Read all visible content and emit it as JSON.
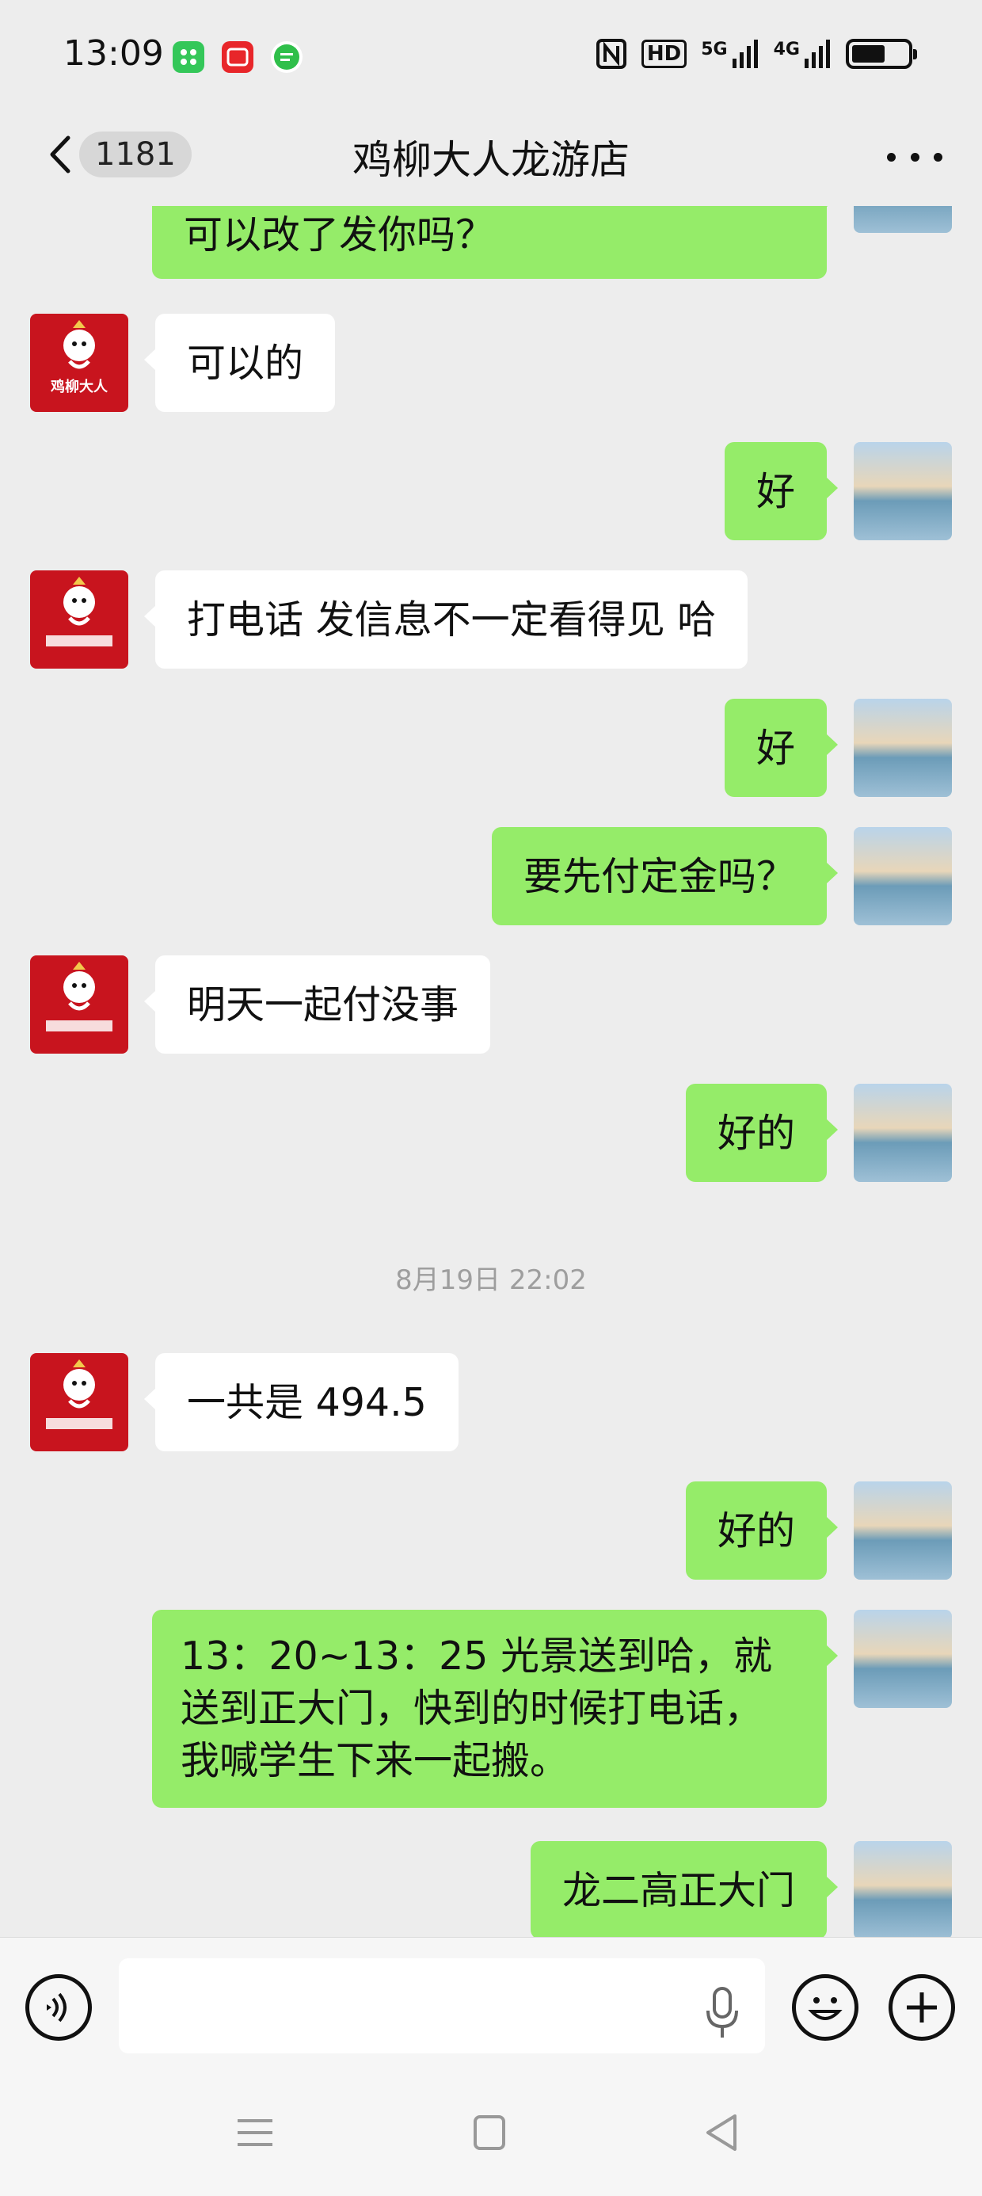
{
  "status_bar": {
    "time": "13:09",
    "network_5g": "5G",
    "network_4g": "4G",
    "hd": "HD",
    "battery_level": 0.6
  },
  "header": {
    "unread_count": "1181",
    "title": "鸡柳大人龙游店"
  },
  "messages": [
    {
      "side": "out",
      "text": "可以改了发你吗？"
    },
    {
      "side": "in",
      "text": "可以的"
    },
    {
      "side": "out",
      "text": "好"
    },
    {
      "side": "in",
      "text": "打电话 发信息不一定看得见 哈"
    },
    {
      "side": "out",
      "text": "好"
    },
    {
      "side": "out",
      "text": "要先付定金吗？"
    },
    {
      "side": "in",
      "text": "明天一起付没事"
    },
    {
      "side": "out",
      "text": "好的"
    },
    {
      "type": "time",
      "text": "8月19日 22:02"
    },
    {
      "side": "in",
      "text": "一共是 494.5"
    },
    {
      "side": "out",
      "text": "好的"
    },
    {
      "side": "out",
      "text": "13：20~13：25 光景送到哈，就送到正大门，快到的时候打电话，我喊学生下来一起搬。"
    },
    {
      "side": "out",
      "text": "龙二高正大门"
    }
  ],
  "shop_avatar_logo_text": "鸡柳大人",
  "colors": {
    "background": "#ededed",
    "outgoing_bubble": "#95ec69",
    "incoming_bubble": "#ffffff",
    "shop_avatar": "#c8141e"
  },
  "icons": {
    "back": "chevron-left-icon",
    "more": "more-dots-icon",
    "voice": "voice-icon",
    "mic": "mic-icon",
    "emoji": "emoji-icon",
    "plus": "plus-icon",
    "nav_menu": "menu-icon",
    "nav_home": "square-icon",
    "nav_back": "triangle-back-icon"
  }
}
